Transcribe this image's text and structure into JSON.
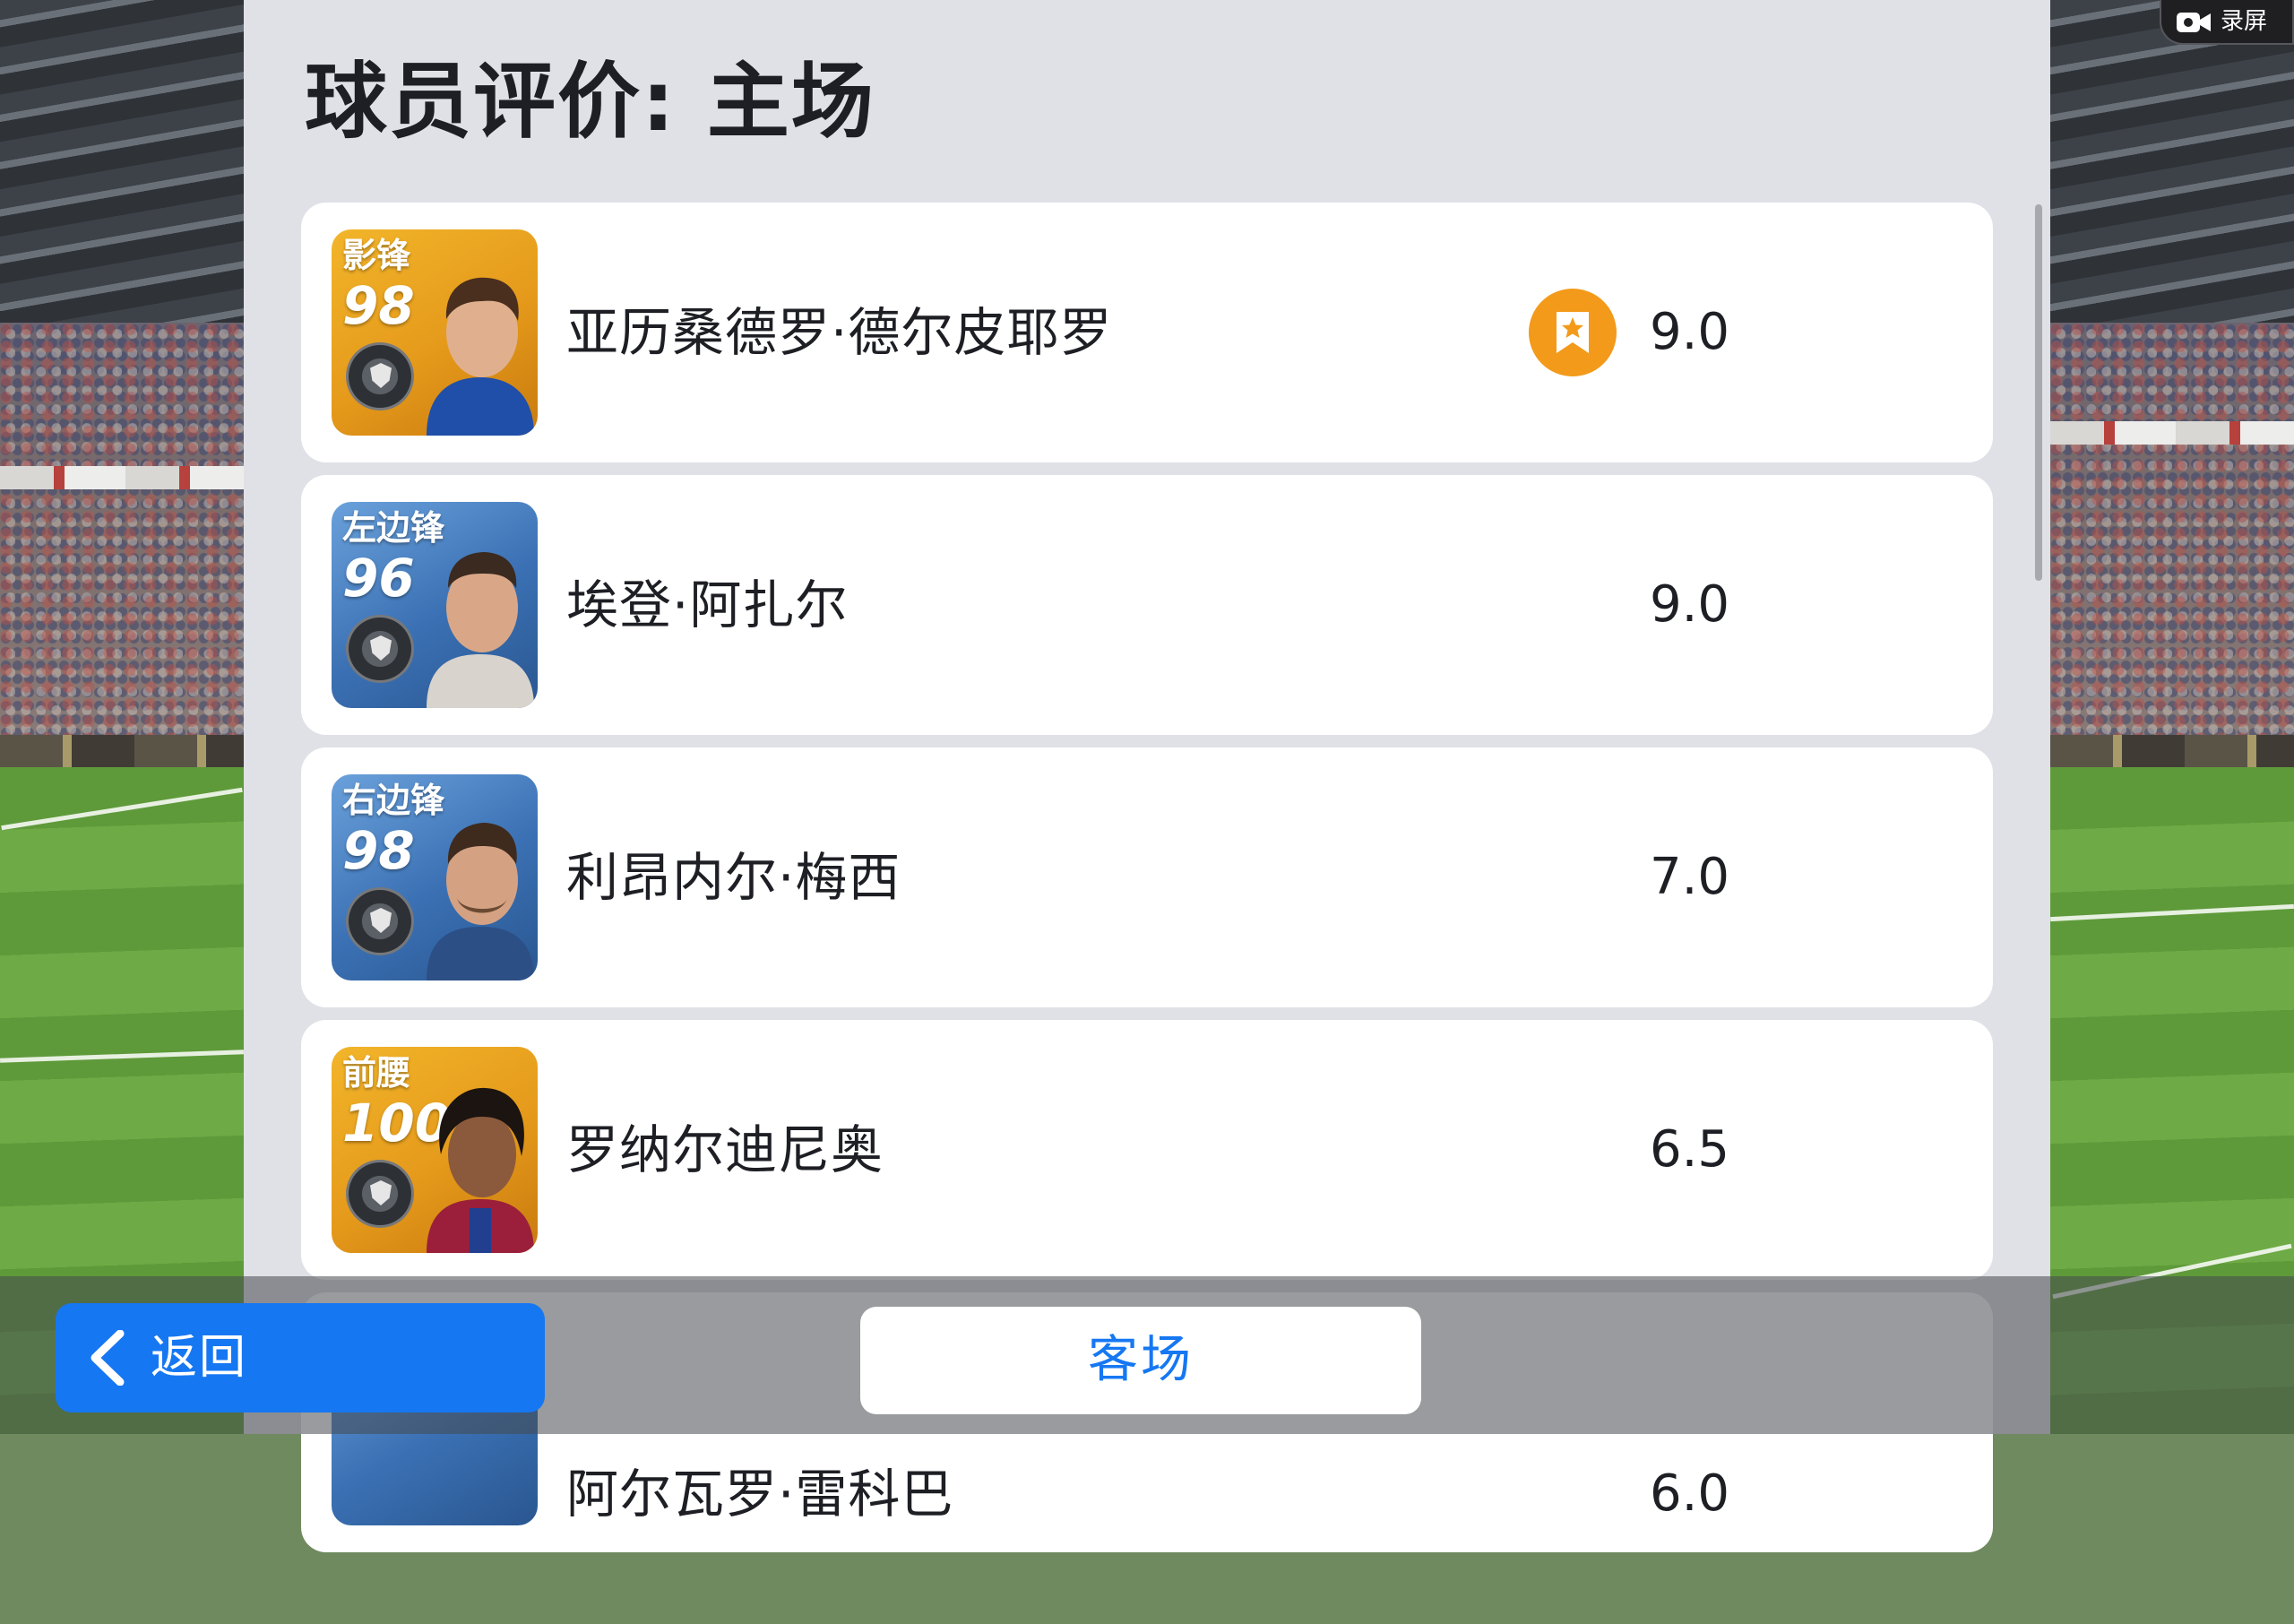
{
  "page": {
    "title": "球员评价: 主场"
  },
  "players": [
    {
      "position": "影锋",
      "rating": "98",
      "name": "亚历桑德罗·德尔皮耶罗",
      "score": "9.0",
      "card_color": "gold",
      "player_of_match": true
    },
    {
      "position": "左边锋",
      "rating": "96",
      "name": "埃登·阿扎尔",
      "score": "9.0",
      "card_color": "blue",
      "player_of_match": false
    },
    {
      "position": "右边锋",
      "rating": "98",
      "name": "利昂内尔·梅西",
      "score": "7.0",
      "card_color": "blue",
      "player_of_match": false
    },
    {
      "position": "前腰",
      "rating": "100",
      "name": "罗纳尔迪尼奥",
      "score": "6.5",
      "card_color": "gold",
      "player_of_match": false
    },
    {
      "position": "",
      "rating": "",
      "name": "阿尔瓦罗·雷科巴",
      "score": "6.0",
      "card_color": "blue",
      "player_of_match": false
    }
  ],
  "footer": {
    "back_label": "返回",
    "away_label": "客场"
  },
  "overlay": {
    "record_label": "录屏"
  },
  "colors": {
    "accent": "#1677f2",
    "potm_badge": "#f39a1a",
    "panel_bg": "#dfe1e6",
    "row_bg": "#ffffff"
  },
  "icons": {
    "potm": "bookmark-star-icon",
    "back": "chevron-left-icon",
    "record": "video-camera-icon"
  }
}
